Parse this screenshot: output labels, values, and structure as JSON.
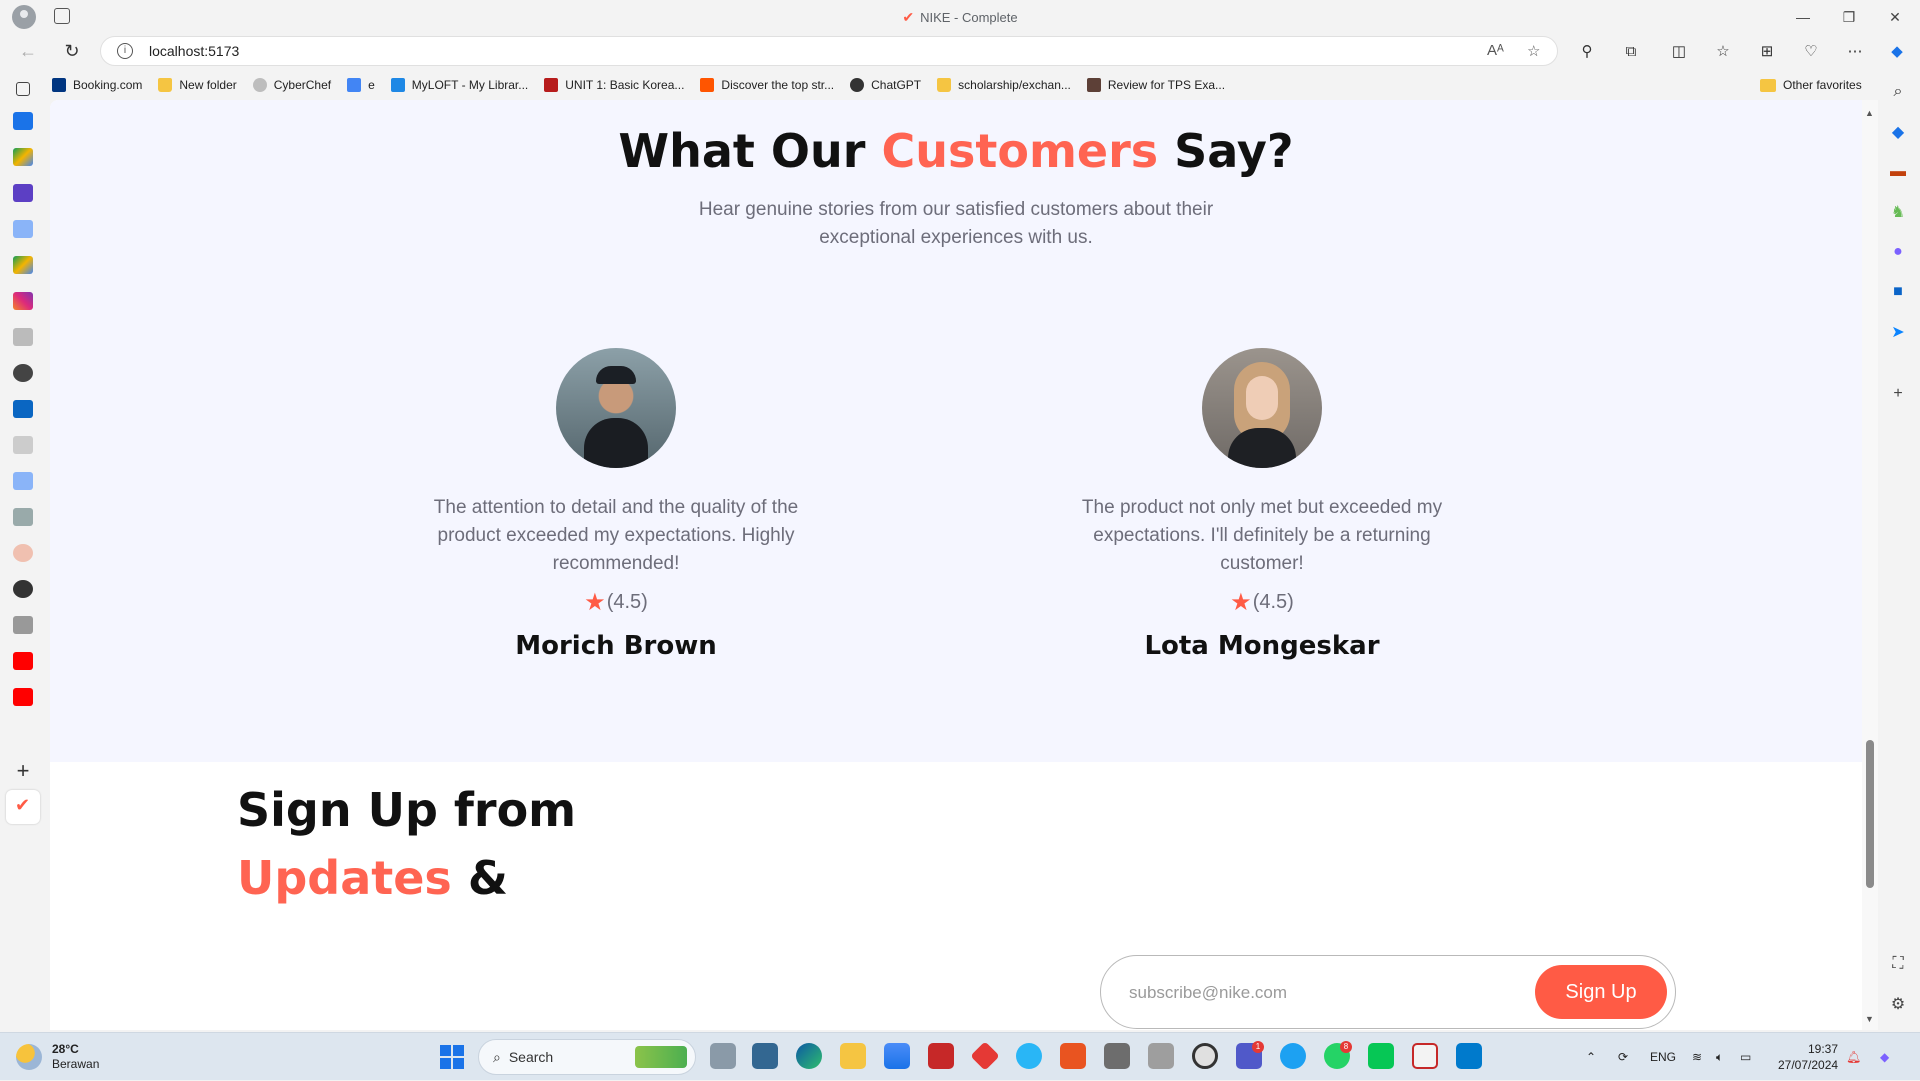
{
  "window": {
    "title": "NIKE - Complete",
    "controls": {
      "minimize": "—",
      "restore": "❐",
      "close": "✕"
    }
  },
  "address_bar": {
    "url": "localhost:5173"
  },
  "bookmarks": [
    {
      "label": "Booking.com",
      "icon": "booking-icon",
      "color": "#003580"
    },
    {
      "label": "New folder",
      "icon": "folder-icon",
      "color": "#f5c542"
    },
    {
      "label": "CyberChef",
      "icon": "cyberchef-icon",
      "color": "#bdbdbd"
    },
    {
      "label": "e",
      "icon": "docs-icon",
      "color": "#4285f4"
    },
    {
      "label": "MyLOFT - My Librar...",
      "icon": "myloft-icon",
      "color": "#1e88e5"
    },
    {
      "label": "UNIT 1: Basic Korea...",
      "icon": "unit-icon",
      "color": "#b71c1c"
    },
    {
      "label": "Discover the top str...",
      "icon": "soundcloud-icon",
      "color": "#ff5500"
    },
    {
      "label": "ChatGPT",
      "icon": "chatgpt-icon",
      "color": "#333333"
    },
    {
      "label": "scholarship/exchan...",
      "icon": "folder-icon",
      "color": "#f5c542"
    },
    {
      "label": "Review for TPS Exa...",
      "icon": "review-icon",
      "color": "#5d4037"
    }
  ],
  "other_favorites": "Other favorites",
  "testimonials": {
    "title_pre": "What Our ",
    "title_accent": "Customers",
    "title_post": " Say?",
    "subtitle": "Hear genuine stories from our satisfied customers about their exceptional experiences with us.",
    "reviews": [
      {
        "quote": "The attention to detail and the quality of the product exceeded my expectations. Highly recommended!",
        "rating_text": "(4.5)",
        "name": "Morich Brown"
      },
      {
        "quote": "The product not only met but exceeded my expectations. I'll definitely be a returning customer!",
        "rating_text": "(4.5)",
        "name": "Lota Mongeskar"
      }
    ]
  },
  "signup": {
    "line1": "Sign Up from",
    "line2_accent": "Updates",
    "line2_post": " &",
    "placeholder": "subscribe@nike.com",
    "button": "Sign Up"
  },
  "taskbar": {
    "weather_temp": "28°C",
    "weather_desc": "Berawan",
    "search_label": "Search",
    "language": "ENG",
    "time": "19:37",
    "date": "27/07/2024",
    "badges": {
      "whatsapp": "8",
      "teams": "1"
    }
  },
  "colors": {
    "accent": "#ff6452",
    "button": "#ff5b45",
    "section_bg": "#f5f6ff"
  }
}
